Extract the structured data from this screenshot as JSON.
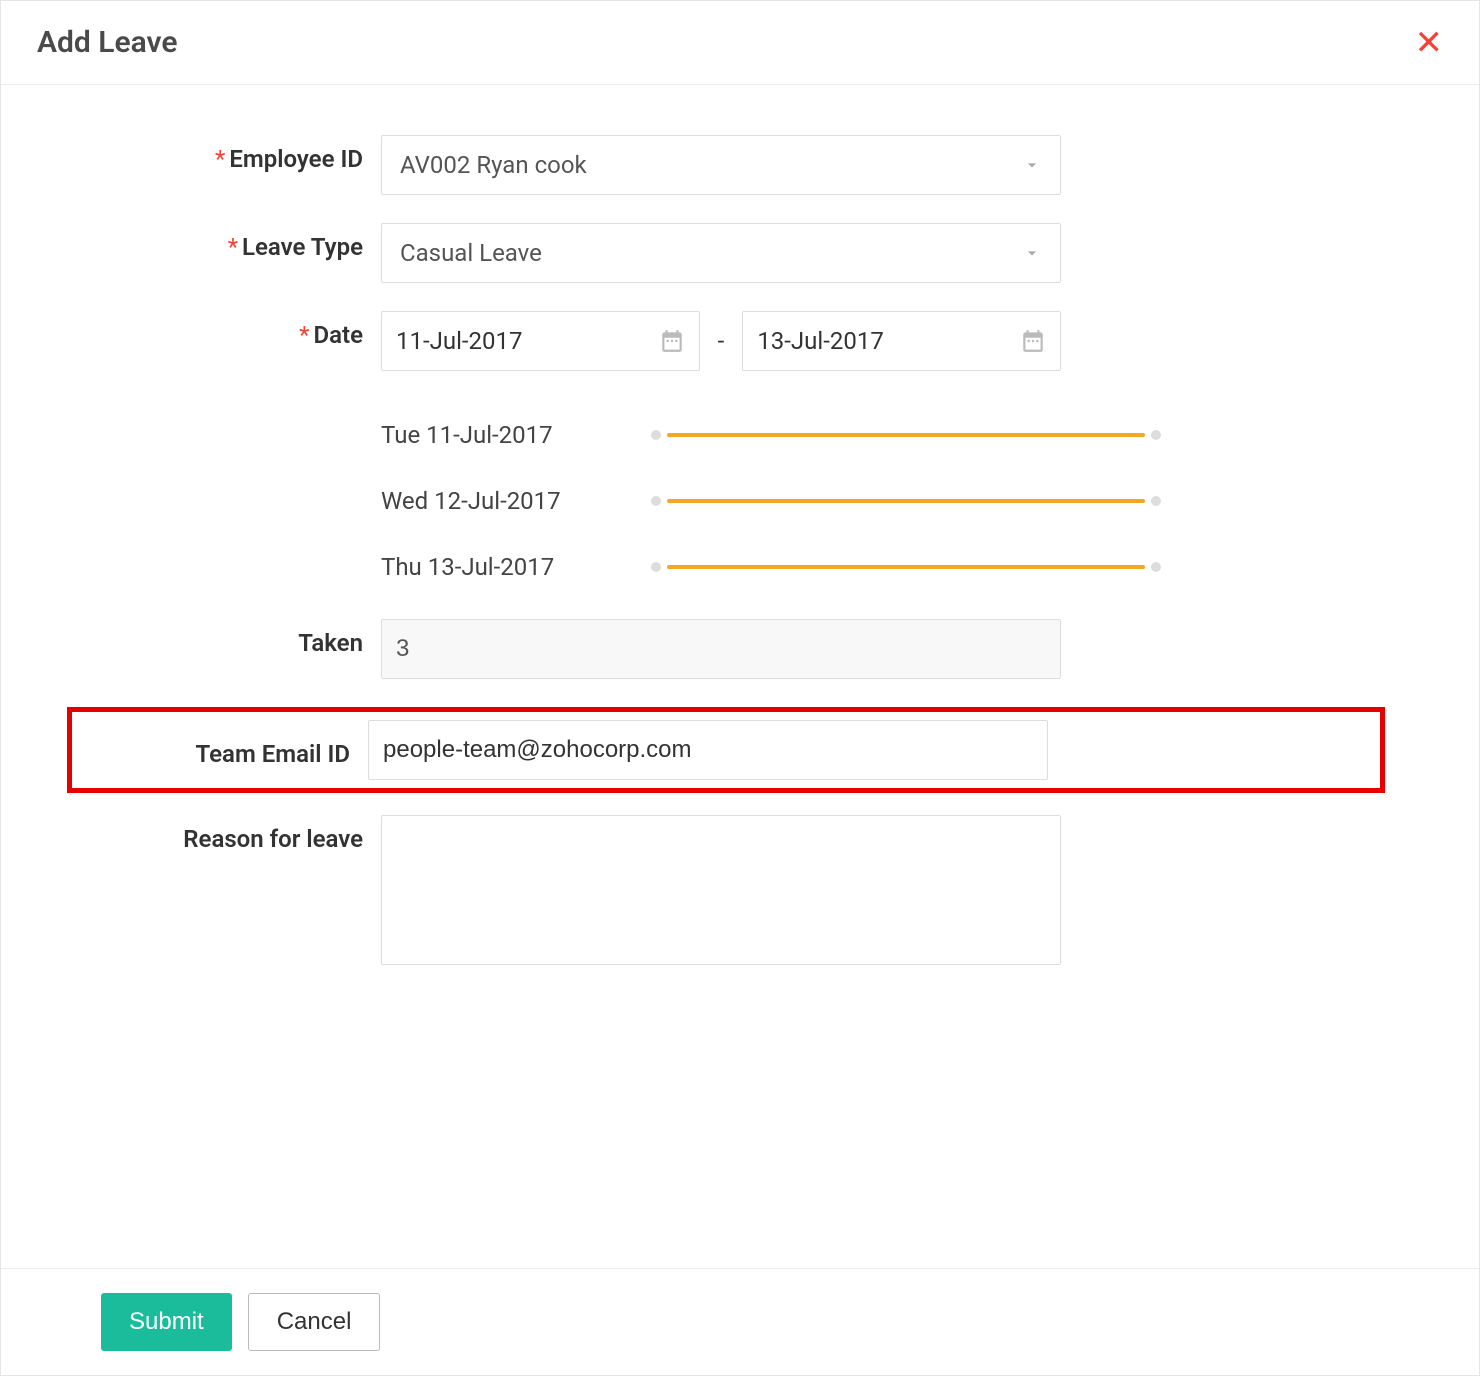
{
  "header": {
    "title": "Add Leave"
  },
  "form": {
    "employee_label": "Employee ID",
    "employee_value": "AV002 Ryan cook",
    "leave_type_label": "Leave Type",
    "leave_type_value": "Casual Leave",
    "date_label": "Date",
    "date_from": "11-Jul-2017",
    "date_sep": "-",
    "date_to": "13-Jul-2017",
    "days": [
      {
        "label": "Tue 11-Jul-2017"
      },
      {
        "label": "Wed 12-Jul-2017"
      },
      {
        "label": "Thu 13-Jul-2017"
      }
    ],
    "taken_label": "Taken",
    "taken_value": "3",
    "team_email_label": "Team Email ID",
    "team_email_value": "people-team@zohocorp.com",
    "reason_label": "Reason for leave",
    "reason_value": ""
  },
  "footer": {
    "submit_label": "Submit",
    "cancel_label": "Cancel"
  }
}
